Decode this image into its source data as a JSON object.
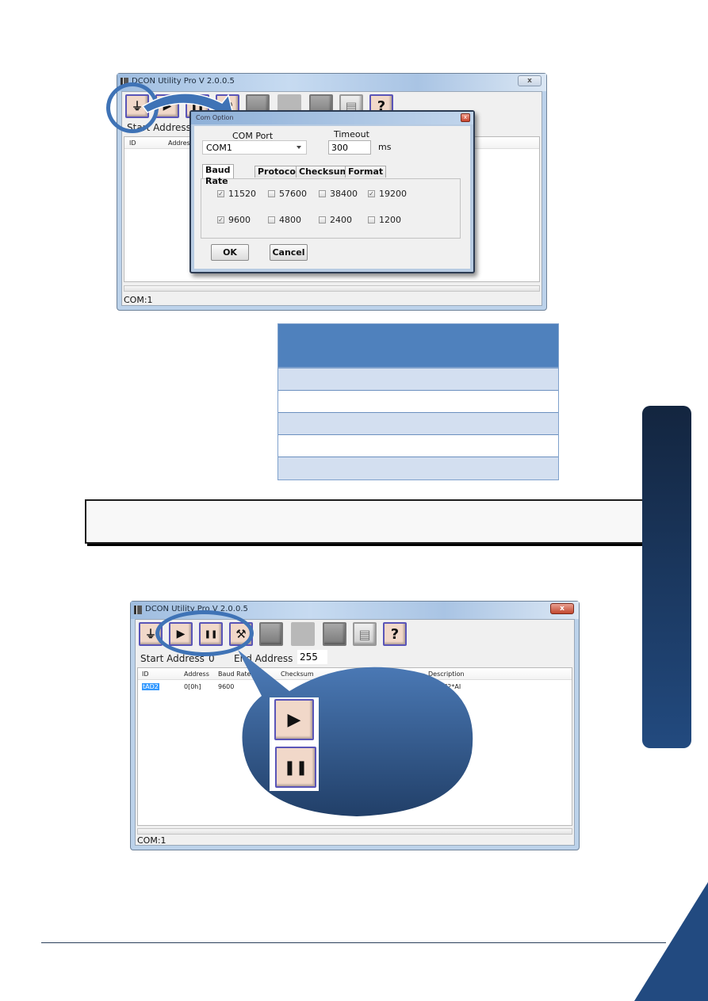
{
  "screenshot1": {
    "window_title": "DCON Utility Pro V 2.0.0.5",
    "close_label": "x",
    "toolbar": [
      {
        "name": "com-port-settings",
        "icon": "serial-port-icon",
        "glyph": "⏚"
      },
      {
        "name": "start-search",
        "icon": "play-icon",
        "glyph": "▶"
      },
      {
        "name": "stop-search",
        "icon": "pause-icon",
        "glyph": "❚❚"
      },
      {
        "name": "tools",
        "icon": "tools-icon",
        "glyph": "⚒"
      },
      {
        "name": "module-1",
        "icon": "module-icon",
        "glyph": ""
      },
      {
        "name": "blank",
        "icon": "blank-icon",
        "glyph": ""
      },
      {
        "name": "module-2",
        "icon": "module-rack-icon",
        "glyph": ""
      },
      {
        "name": "document",
        "icon": "document-icon",
        "glyph": "▤"
      },
      {
        "name": "help",
        "icon": "help-icon",
        "glyph": "?"
      }
    ],
    "start_address_label": "Start Address",
    "grid_headers": [
      "ID",
      "Address"
    ],
    "status": "COM:1",
    "dialog": {
      "title": "Com Option",
      "close_label": "x",
      "com_port_label": "COM Port",
      "com_port_value": "COM1",
      "timeout_label": "Timeout",
      "timeout_value": "300",
      "timeout_unit": "ms",
      "tabs": [
        {
          "label": "Baud Rate",
          "active": true
        },
        {
          "label": "Protocol",
          "active": false
        },
        {
          "label": "Checksum",
          "active": false
        },
        {
          "label": "Format",
          "active": false
        }
      ],
      "baud_rates": [
        {
          "label": "11520",
          "checked": true
        },
        {
          "label": "57600",
          "checked": false
        },
        {
          "label": "38400",
          "checked": false
        },
        {
          "label": "19200",
          "checked": true
        },
        {
          "label": "9600",
          "checked": true
        },
        {
          "label": "4800",
          "checked": false
        },
        {
          "label": "2400",
          "checked": false
        },
        {
          "label": "1200",
          "checked": false
        }
      ],
      "ok_label": "OK",
      "cancel_label": "Cancel"
    }
  },
  "screenshot2": {
    "window_title": "DCON Utility Pro V 2.0.0.5",
    "close_label": "x",
    "start_address_label": "Start Address",
    "start_address_value": "0",
    "end_address_label": "End Address",
    "end_address_value": "255",
    "grid_headers": [
      "ID",
      "Address",
      "Baud Rate",
      "Checksum",
      "Description"
    ],
    "grid_rows": [
      {
        "id": "tAD2",
        "address": "0[0h]",
        "baud": "9600",
        "checksum": "",
        "description": "[DCON]2*AI"
      }
    ],
    "status": "COM:1",
    "callout_buttons": [
      {
        "icon": "play-icon",
        "glyph": "▶"
      },
      {
        "icon": "pause-icon",
        "glyph": "❚❚"
      }
    ]
  },
  "colors": {
    "accent_blue": "#4f81bd",
    "sidebar_dark": "#13253f",
    "sidebar_light": "#224a7f",
    "callout_blue": "#3f73b6"
  }
}
